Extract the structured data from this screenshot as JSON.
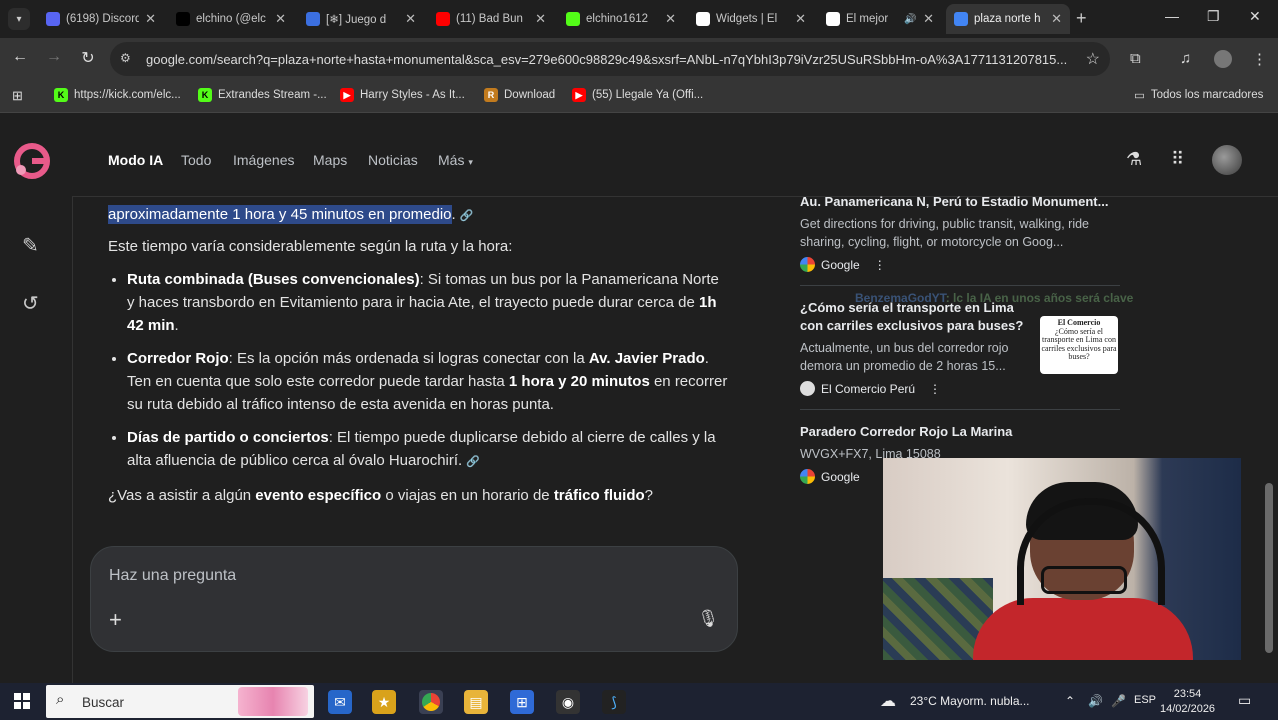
{
  "tabs": [
    {
      "favicon": "discord-icon",
      "title": "(6198) Discord",
      "color": "#5865f2"
    },
    {
      "favicon": "tiktok-icon",
      "title": "elchino (@elc",
      "color": "#000000"
    },
    {
      "favicon": "game-icon",
      "title": "[❄] Juego d",
      "color": "#3b6fe0"
    },
    {
      "favicon": "youtube-icon",
      "title": "(11) Bad Bun",
      "color": "#ff0000"
    },
    {
      "favicon": "kick-icon",
      "title": "elchino1612",
      "color": "#53fc18"
    },
    {
      "favicon": "widget-icon",
      "title": "Widgets | El",
      "color": "#ffffff"
    },
    {
      "favicon": "generic-icon",
      "title": "El mejor",
      "color": "#ffffff"
    },
    {
      "favicon": "google-icon",
      "title": "plaza norte h",
      "color": "#4285f4"
    }
  ],
  "browser": {
    "url": "google.com/search?q=plaza+norte+hasta+monumental&sca_esv=279e600c98829c49&sxsrf=ANbL-n7qYbhI3p79iVzr25USuRSbbHm-oA%3A1771131207815...",
    "bookmarks": [
      {
        "label": "https://kick.com/elc...",
        "favicon": "kick-icon",
        "color": "#53fc18",
        "glyph": "K"
      },
      {
        "label": "Extrandes Stream -...",
        "favicon": "kick-icon",
        "color": "#53fc18",
        "glyph": "K"
      },
      {
        "label": "Harry Styles - As It...",
        "favicon": "youtube-icon",
        "color": "#ff0000",
        "glyph": "▶"
      },
      {
        "label": "Download",
        "favicon": "download-site-icon",
        "color": "#c27b1e",
        "glyph": "R"
      },
      {
        "label": "(55) Llegale Ya (Offi...",
        "favicon": "youtube-icon",
        "color": "#ff0000",
        "glyph": "▶"
      }
    ],
    "all_bookmarks": "Todos los marcadores"
  },
  "search_nav": {
    "tabs": [
      "Modo IA",
      "Todo",
      "Imágenes",
      "Maps",
      "Noticias",
      "Más"
    ]
  },
  "answer": {
    "lead_highlight": "aproximadamente 1 hora y 45 minutos en promedio",
    "lead_end": ".",
    "intro": "Este tiempo varía considerablemente según la ruta y la hora:",
    "bullets": [
      {
        "title": "Ruta combinada (Buses convencionales)",
        "text1": ": Si tomas un bus por la Panamericana Norte y haces transbordo en Evitamiento para ir hacia Ate, el trayecto puede durar cerca de ",
        "bold1": "1h 42 min",
        "text2": "."
      },
      {
        "title": "Corredor Rojo",
        "text1": ": Es la opción más ordenada si logras conectar con la ",
        "bold1": "Av. Javier Prado",
        "text2": ". Ten en cuenta que solo este corredor puede tardar hasta ",
        "bold2": "1 hora y 20 minutos",
        "text3": " en recorrer su ruta debido al tráfico intenso de esta avenida en horas punta."
      },
      {
        "title": "Días de partido o conciertos",
        "text1": ": El tiempo puede duplicarse debido al cierre de calles y la alta afluencia de público cerca al óvalo Huarochirí."
      }
    ],
    "question_a": "¿Vas a asistir a algún ",
    "question_b": "evento específico",
    "question_c": " o viajas en un horario de ",
    "question_d": "tráfico fluido",
    "question_e": "?"
  },
  "ask": {
    "placeholder": "Haz una pregunta"
  },
  "sources": [
    {
      "title": "Au. Panamericana N, Perú to Estadio Monument...",
      "desc": "Get directions for driving, public transit, walking, ride sharing, cycling, flight, or motorcycle on Goog...",
      "site": "Google"
    },
    {
      "title": "¿Cómo sería el transporte en Lima con carriles exclusivos para buses?",
      "desc": "Actualmente, un bus del corredor rojo demora un promedio de 2 horas 15...",
      "site": "El Comercio Perú"
    },
    {
      "title": "Paradero Corredor Rojo La Marina",
      "desc": "WVGX+FX7, Lima 15088",
      "site": "Google"
    }
  ],
  "thumb": {
    "brand": "El Comercio",
    "caption": "¿Cómo sería el transporte en Lima con carriles exclusivos para buses?"
  },
  "stream_overlay": {
    "user": "BenzemaGodYT",
    "message": ": lc la IA en unos años será clave"
  },
  "taskbar": {
    "search": "Buscar",
    "weather": "23°C  Mayorm. nubla...",
    "lang": "ESP",
    "time": "23:54",
    "date": "14/02/2026"
  }
}
